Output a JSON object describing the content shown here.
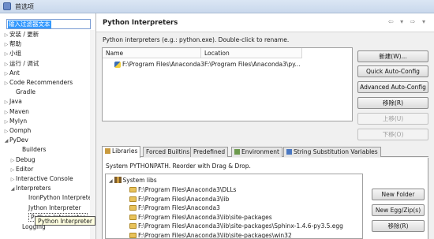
{
  "window": {
    "title": "首选项",
    "filter_text": "输入过滤器文本"
  },
  "sidebar": {
    "items": [
      {
        "label": "安装 / 更新",
        "arrow": "▷"
      },
      {
        "label": "帮助",
        "arrow": "▷"
      },
      {
        "label": "小组",
        "arrow": "▷"
      },
      {
        "label": "运行 / 调试",
        "arrow": "▷"
      },
      {
        "label": "Ant",
        "arrow": "▷"
      },
      {
        "label": "Code Recommenders",
        "arrow": "▷"
      },
      {
        "label": "Gradle",
        "arrow": ""
      },
      {
        "label": "Java",
        "arrow": "▷"
      },
      {
        "label": "Maven",
        "arrow": "▷"
      },
      {
        "label": "Mylyn",
        "arrow": "▷"
      },
      {
        "label": "Oomph",
        "arrow": "▷"
      },
      {
        "label": "PyDev",
        "arrow": "◢"
      },
      {
        "label": "Builders",
        "arrow": ""
      },
      {
        "label": "Debug",
        "arrow": "▷"
      },
      {
        "label": "Editor",
        "arrow": "▷"
      },
      {
        "label": "Interactive Console",
        "arrow": "▷"
      },
      {
        "label": "Interpreters",
        "arrow": "◢"
      },
      {
        "label": "IronPython Interpreter",
        "arrow": ""
      },
      {
        "label": "Jython Interpreter",
        "arrow": ""
      },
      {
        "label": "Python Interpreter",
        "arrow": ""
      },
      {
        "label": "Logging",
        "arrow": ""
      }
    ],
    "tooltip": "Python Interpreter"
  },
  "page": {
    "title": "Python Interpreters",
    "nav": "⇦ ▾ ⇨ ▾",
    "description": "Python interpreters (e.g.: python.exe).   Double-click to rename."
  },
  "interpreters": {
    "columns": [
      "Name",
      "Location"
    ],
    "rows": [
      {
        "name": "F:\\Program Files\\Anaconda3",
        "location": "F:\\Program Files\\Anaconda3\\py..."
      }
    ]
  },
  "buttons": {
    "new": "新建(W)...",
    "quick_auto": "Quick Auto-Config",
    "advanced_auto": "Advanced Auto-Config",
    "remove": "移除(R)",
    "up": "上移(U)",
    "down": "下移(O)"
  },
  "tabs": [
    {
      "label": "Libraries",
      "active": true
    },
    {
      "label": "Forced Builtins",
      "active": false
    },
    {
      "label": "Predefined",
      "active": false
    },
    {
      "label": "Environment",
      "active": false
    },
    {
      "label": "String Substitution Variables",
      "active": false
    }
  ],
  "libraries": {
    "description": "System PYTHONPATH.   Reorder with Drag & Drop.",
    "root": "System libs",
    "paths": [
      "F:\\Program Files\\Anaconda3\\DLLs",
      "F:\\Program Files\\Anaconda3\\lib",
      "F:\\Program Files\\Anaconda3",
      "F:\\Program Files\\Anaconda3\\lib\\site-packages",
      "F:\\Program Files\\Anaconda3\\lib\\site-packages\\Sphinx-1.4.6-py3.5.egg",
      "F:\\Program Files\\Anaconda3\\lib\\site-packages\\win32"
    ],
    "buttons": {
      "new_folder": "New Folder",
      "new_egg": "New Egg/Zip(s)",
      "remove": "移除(R)"
    }
  },
  "colors": {
    "selection": "#3399ff",
    "tooltip_bg": "#ffffe1"
  }
}
